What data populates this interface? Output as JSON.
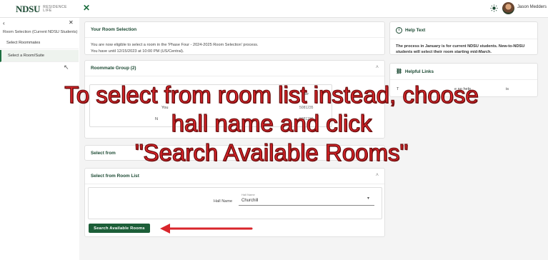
{
  "header": {
    "logo_main": "NDSU",
    "logo_sub_line1": "RESIDENCE",
    "logo_sub_line2": "LIFE",
    "user_name": "Jason Medders"
  },
  "sidebar": {
    "section_title": "Room Selection (Current NDSU Students)",
    "items": [
      {
        "label": "Select Roommates"
      },
      {
        "label": "Select a Room/Suite"
      }
    ]
  },
  "your_room": {
    "title": "Your Room Selection",
    "line1": "You are now eligible to select a room in the 'Phase Four - 2024-2025 Room Selection' process.",
    "line2": "You have until 12/15/2023 at 10:00 PM (US/Central)."
  },
  "roommate_group": {
    "title": "Roommate Group (2)",
    "frag1": "You",
    "frag2": "N",
    "frag3": "ber",
    "frag4": "5081235",
    "frag5": "5081236"
  },
  "select_from_suite": {
    "title": "Select from"
  },
  "room_list": {
    "title": "Select from Room List",
    "hall_label": "Hall Name",
    "select_small_label": "Hall Name",
    "select_value": "Churchill",
    "search_button": "Search Available Rooms"
  },
  "help_text": {
    "title": "Help Text",
    "body": "The process in January is for current NDSU students. New-to-NDSU students will select their room starting mid-March."
  },
  "helpful_links": {
    "title": "Helpful Links",
    "frag1": "T",
    "frag2": "e no help",
    "frag3": "is"
  },
  "overlay": {
    "line1": "To select from room list instead, choose",
    "line2": "hall name and click",
    "line3": "\"Search Available Rooms\""
  },
  "colors": {
    "brand_green": "#1c5e38",
    "overlay_red": "#e4242a"
  }
}
